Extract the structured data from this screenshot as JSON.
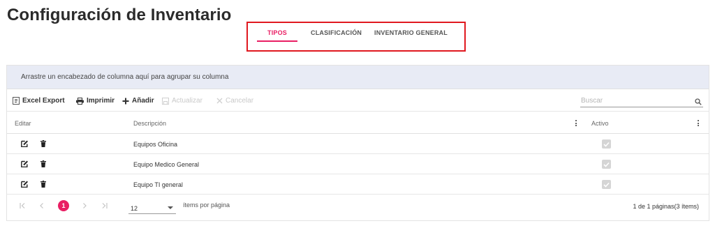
{
  "page": {
    "title": "Configuración de Inventario"
  },
  "tabs": [
    {
      "label": "TIPOS",
      "active": true
    },
    {
      "label": "CLASIFICACIÓN",
      "active": false
    },
    {
      "label": "INVENTARIO GENERAL",
      "active": false
    }
  ],
  "grid": {
    "group_hint": "Arrastre un encabezado de columna aquí para agrupar su columna",
    "toolbar": {
      "excel_export": "Excel Export",
      "print": "Imprimir",
      "add": "Añadir",
      "update": "Actualizar",
      "cancel": "Cancelar",
      "search_placeholder": "Buscar"
    },
    "columns": {
      "edit": "Editar",
      "description": "Descripción",
      "active": "Activo"
    },
    "rows": [
      {
        "description": "Equipos Oficina",
        "active": true
      },
      {
        "description": "Equipo Medico General",
        "active": true
      },
      {
        "description": "Equipo TI general",
        "active": true
      }
    ],
    "pager": {
      "current_page": "1",
      "page_size": "12",
      "per_page_label": "ítems por página",
      "info": "1 de 1 páginas(3 ítems)"
    }
  },
  "colors": {
    "accent": "#e91e63",
    "highlight_box": "#e0181f",
    "group_bar": "#e8ebf5"
  },
  "icons": [
    "excel-export-icon",
    "print-icon",
    "add-icon",
    "update-icon",
    "cancel-icon",
    "search-icon",
    "edit-icon",
    "trash-icon",
    "column-menu-icon",
    "checkbox-check-icon",
    "first-page-icon",
    "prev-page-icon",
    "next-page-icon",
    "last-page-icon",
    "dropdown-caret-icon"
  ]
}
